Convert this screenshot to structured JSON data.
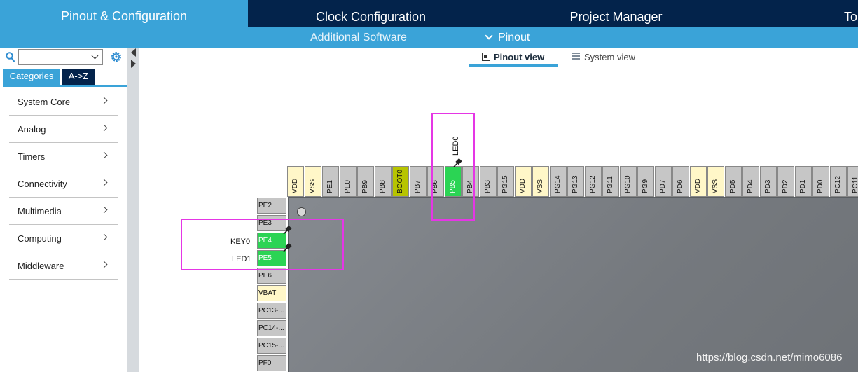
{
  "top_tabs": [
    {
      "label": "Pinout & Configuration",
      "active": true
    },
    {
      "label": "Clock Configuration",
      "active": false
    },
    {
      "label": "Project Manager",
      "active": false
    },
    {
      "label": "To",
      "active": false
    }
  ],
  "sub_bar": {
    "additional_software": "Additional Software",
    "pinout": "Pinout"
  },
  "left_panel": {
    "search_value": "",
    "tabs": [
      "Categories",
      "A->Z"
    ],
    "categories": [
      "System Core",
      "Analog",
      "Timers",
      "Connectivity",
      "Multimedia",
      "Computing",
      "Middleware"
    ]
  },
  "view_tabs": {
    "pinout_view": "Pinout view",
    "system_view": "System view"
  },
  "top_pins": [
    {
      "name": "VDD",
      "type": "power"
    },
    {
      "name": "VSS",
      "type": "power"
    },
    {
      "name": "PE1",
      "type": "normal"
    },
    {
      "name": "PE0",
      "type": "normal"
    },
    {
      "name": "PB9",
      "type": "normal"
    },
    {
      "name": "PB8",
      "type": "normal"
    },
    {
      "name": "BOOT0",
      "type": "boot"
    },
    {
      "name": "PB7",
      "type": "normal"
    },
    {
      "name": "PB6",
      "type": "normal"
    },
    {
      "name": "PB5",
      "type": "gpio"
    },
    {
      "name": "PB4",
      "type": "normal"
    },
    {
      "name": "PB3",
      "type": "normal"
    },
    {
      "name": "PG15",
      "type": "normal"
    },
    {
      "name": "VDD",
      "type": "power"
    },
    {
      "name": "VSS",
      "type": "power"
    },
    {
      "name": "PG14",
      "type": "normal"
    },
    {
      "name": "PG13",
      "type": "normal"
    },
    {
      "name": "PG12",
      "type": "normal"
    },
    {
      "name": "PG11",
      "type": "normal"
    },
    {
      "name": "PG10",
      "type": "normal"
    },
    {
      "name": "PG9",
      "type": "normal"
    },
    {
      "name": "PD7",
      "type": "normal"
    },
    {
      "name": "PD6",
      "type": "normal"
    },
    {
      "name": "VDD",
      "type": "power"
    },
    {
      "name": "VSS",
      "type": "power"
    },
    {
      "name": "PD5",
      "type": "normal"
    },
    {
      "name": "PD4",
      "type": "normal"
    },
    {
      "name": "PD3",
      "type": "normal"
    },
    {
      "name": "PD2",
      "type": "normal"
    },
    {
      "name": "PD1",
      "type": "normal"
    },
    {
      "name": "PD0",
      "type": "normal"
    },
    {
      "name": "PC12",
      "type": "normal"
    },
    {
      "name": "PC11",
      "type": "normal"
    }
  ],
  "left_pins": [
    {
      "name": "PE2",
      "type": "normal"
    },
    {
      "name": "PE3",
      "type": "normal"
    },
    {
      "name": "PE4",
      "type": "gpio"
    },
    {
      "name": "PE5",
      "type": "gpio"
    },
    {
      "name": "PE6",
      "type": "normal"
    },
    {
      "name": "VBAT",
      "type": "power"
    },
    {
      "name": "PC13-...",
      "type": "normal"
    },
    {
      "name": "PC14-...",
      "type": "normal"
    },
    {
      "name": "PC15-...",
      "type": "normal"
    },
    {
      "name": "PF0",
      "type": "normal"
    }
  ],
  "pin_labels": {
    "pb5": "LED0",
    "pe4": "KEY0",
    "pe5": "LED1"
  },
  "watermark": "https://blog.csdn.net/mimo6086",
  "colors": {
    "dark_navy": "#03234b",
    "accent_blue": "#3aa3d8",
    "gpio_green": "#2bd454",
    "power_yellow": "#fff7c8",
    "boot_olive": "#b7c400",
    "highlight_magenta": "#e536e5"
  }
}
